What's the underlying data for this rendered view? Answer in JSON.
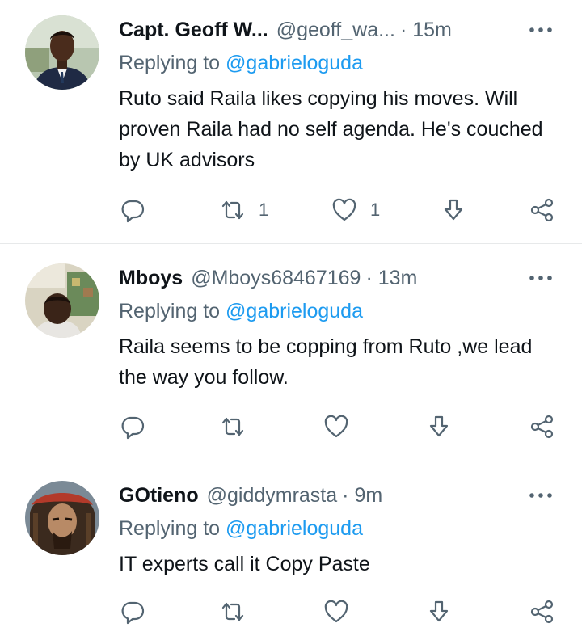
{
  "tweets": [
    {
      "name": "Capt. Geoff W...",
      "handle": "@geoff_wa...",
      "time": "· 15m",
      "replying_prefix": "Replying to ",
      "replying_to": "@gabrieloguda",
      "text": "Ruto said Raila likes copying his moves. Will proven Raila had no self agenda. He's couched by UK advisors",
      "retweets": "1",
      "likes": "1"
    },
    {
      "name": "Mboys",
      "handle": "@Mboys68467169",
      "time": "· 13m",
      "replying_prefix": "Replying to ",
      "replying_to": "@gabrieloguda",
      "text": "Raila seems to be copping from Ruto ,we lead the  way you follow.",
      "retweets": "",
      "likes": ""
    },
    {
      "name": "GOtieno",
      "handle": "@giddymrasta",
      "time": "· 9m",
      "replying_prefix": "Replying to ",
      "replying_to": "@gabrieloguda",
      "text": "IT experts call it Copy Paste",
      "retweets": "",
      "likes": ""
    }
  ],
  "icons": {
    "reply": "reply-icon",
    "retweet": "retweet-icon",
    "like": "heart-icon",
    "download": "download-icon",
    "share": "share-icon",
    "more": "more-icon"
  },
  "colors": {
    "mention": "#1d9bf0",
    "secondary": "#536471",
    "divider": "#e7e9ea"
  }
}
